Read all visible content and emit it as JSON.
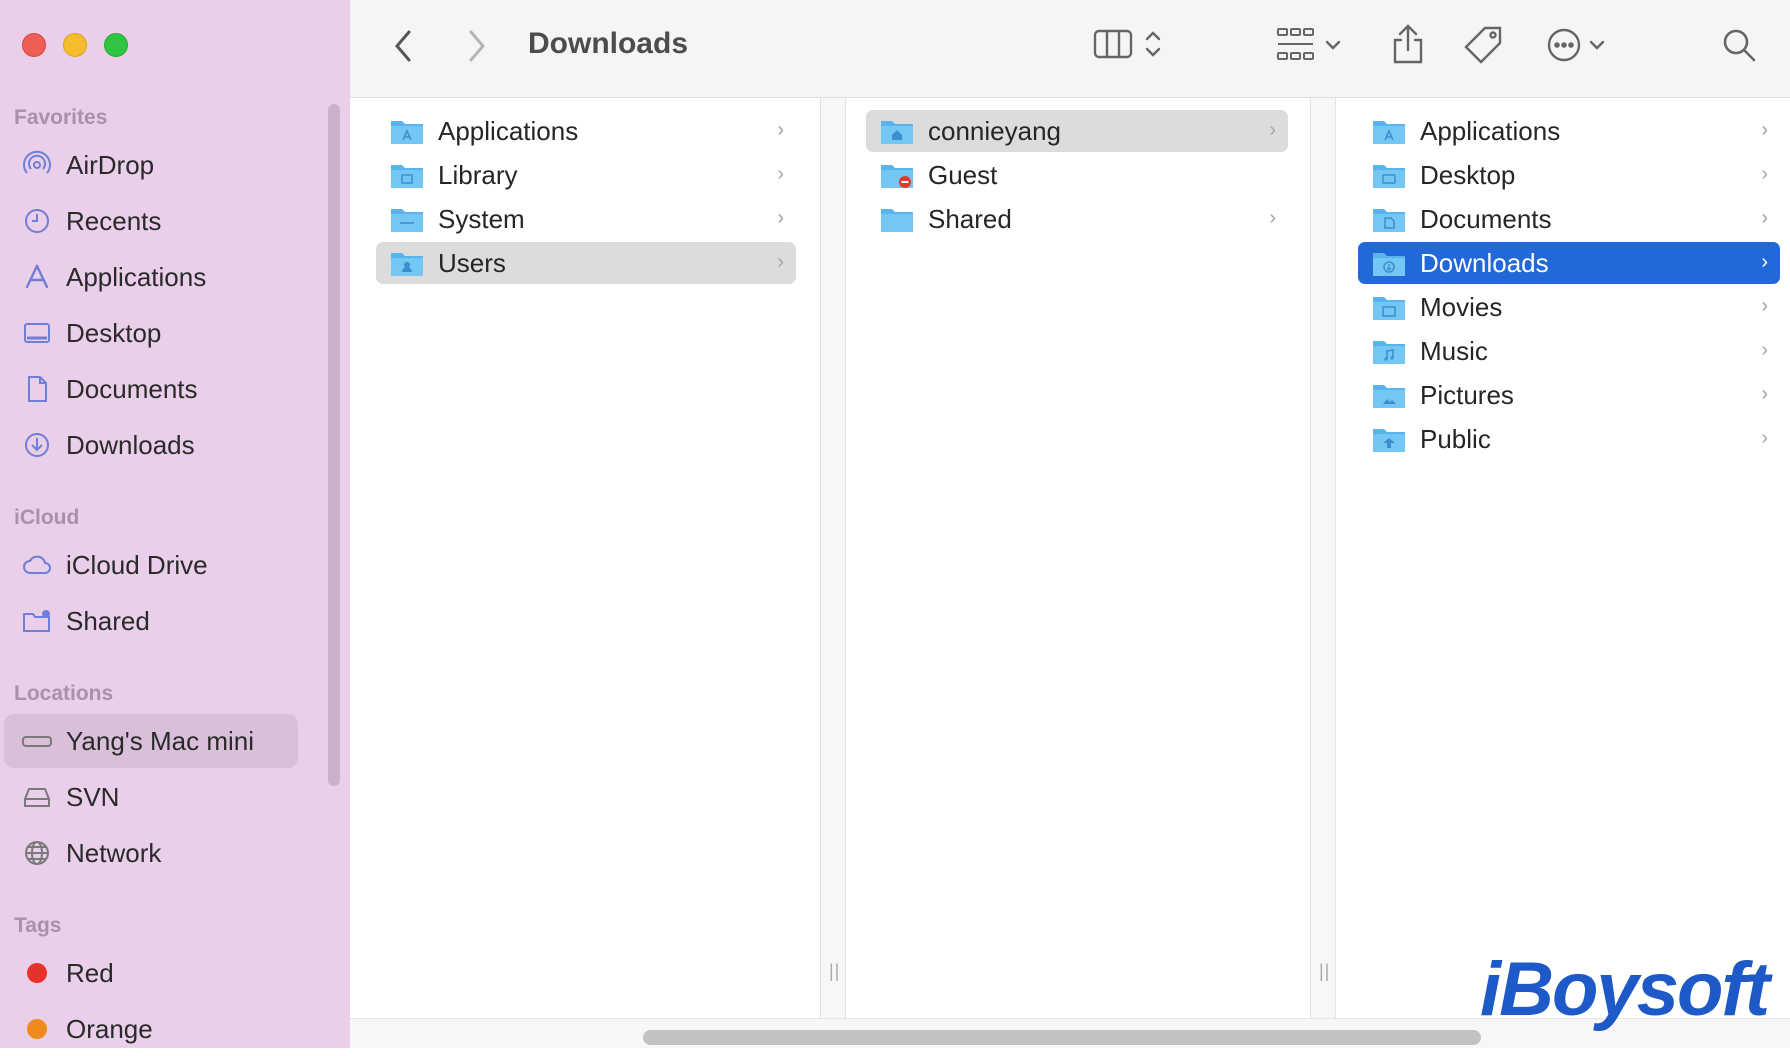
{
  "window": {
    "title": "Downloads"
  },
  "sidebar": {
    "favorites_title": "Favorites",
    "favorites": [
      {
        "label": "AirDrop",
        "icon": "airdrop-icon"
      },
      {
        "label": "Recents",
        "icon": "clock-icon"
      },
      {
        "label": "Applications",
        "icon": "applications-icon"
      },
      {
        "label": "Desktop",
        "icon": "desktop-icon"
      },
      {
        "label": "Documents",
        "icon": "document-icon"
      },
      {
        "label": "Downloads",
        "icon": "download-icon"
      }
    ],
    "icloud_title": "iCloud",
    "icloud": [
      {
        "label": "iCloud Drive",
        "icon": "cloud-icon"
      },
      {
        "label": "Shared",
        "icon": "shared-folder-icon"
      }
    ],
    "locations_title": "Locations",
    "locations": [
      {
        "label": "Yang's Mac mini",
        "icon": "computer-icon",
        "selected": true
      },
      {
        "label": "SVN",
        "icon": "drive-icon"
      },
      {
        "label": "Network",
        "icon": "globe-icon"
      }
    ],
    "tags_title": "Tags",
    "tags": [
      {
        "label": "Red",
        "color": "#e8312a"
      },
      {
        "label": "Orange",
        "color": "#f08a1a"
      }
    ]
  },
  "columns": [
    {
      "items": [
        {
          "label": "Applications",
          "has_children": true
        },
        {
          "label": "Library",
          "has_children": true
        },
        {
          "label": "System",
          "has_children": true
        },
        {
          "label": "Users",
          "has_children": true,
          "selected": "gray"
        }
      ]
    },
    {
      "items": [
        {
          "label": "connieyang",
          "has_children": true,
          "selected": "gray"
        },
        {
          "label": "Guest",
          "has_children": false
        },
        {
          "label": "Shared",
          "has_children": true
        }
      ]
    },
    {
      "items": [
        {
          "label": "Applications",
          "has_children": true
        },
        {
          "label": "Desktop",
          "has_children": true
        },
        {
          "label": "Documents",
          "has_children": true
        },
        {
          "label": "Downloads",
          "has_children": true,
          "selected": "blue"
        },
        {
          "label": "Movies",
          "has_children": true
        },
        {
          "label": "Music",
          "has_children": true
        },
        {
          "label": "Pictures",
          "has_children": true
        },
        {
          "label": "Public",
          "has_children": true
        }
      ]
    }
  ],
  "colors": {
    "sidebar": "#e9cfe9",
    "accent": "#2268d6",
    "folder": "#5ab4ec"
  },
  "watermark": "iBoysoft"
}
